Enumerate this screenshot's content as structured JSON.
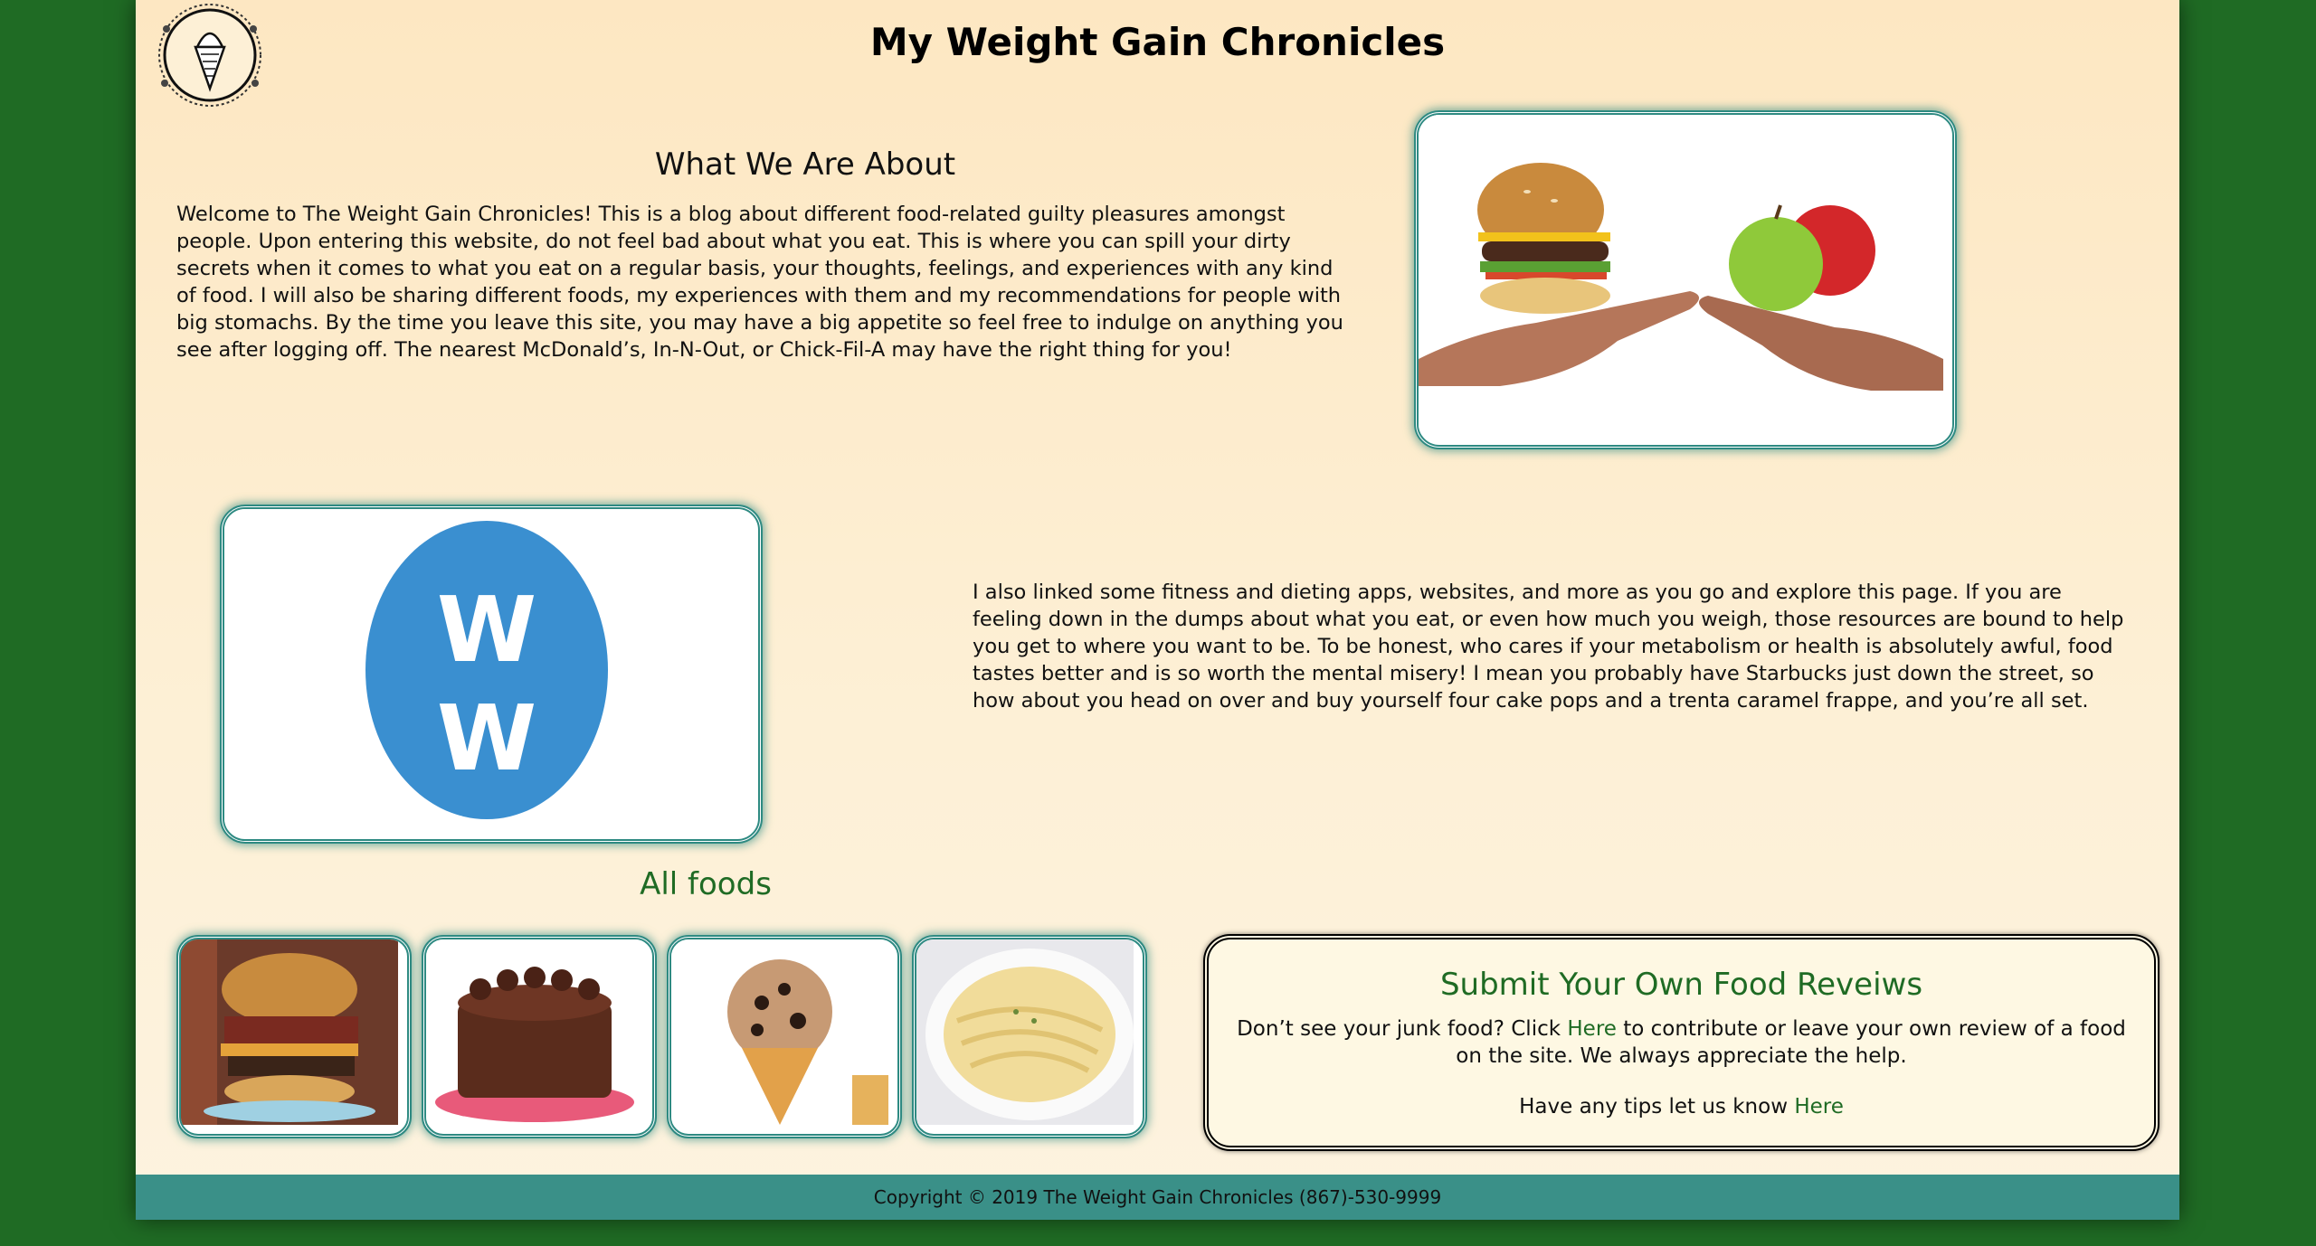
{
  "site": {
    "title": "My Weight Gain Chronicles"
  },
  "about": {
    "heading": "What We Are About",
    "paragraph1": "Welcome to The Weight Gain Chronicles! This is a blog about different food-related guilty pleasures amongst people. Upon entering this website, do not feel bad about what you eat. This is where you can spill your dirty secrets when it comes to what you eat on a regular basis, your thoughts, feelings, and experiences with any kind of food. I will also be sharing different foods, my experiences with them and my recommendations for people with big stomachs. By the time you leave this site, you may have a big appetite so feel free to indulge on anything you see after logging off. The nearest McDonald’s, In-N-Out, or Chick-Fil-A may have the right thing for you!",
    "paragraph2": "I also linked some fitness and dieting apps, websites, and more as you go and explore this page. If you are feeling down in the dumps about what you eat, or even how much you weigh, those resources are bound to help you get to where you want to be. To be honest, who cares if your metabolism or health is absolutely awful, food tastes better and is so worth the mental misery! I mean you probably have Starbucks just down the street, so how about you head on over and buy yourself four cake pops and a trenta caramel frappe, and you’re all set."
  },
  "foods": {
    "heading": "All foods"
  },
  "submit": {
    "heading": "Submit Your Own Food Reveiws",
    "text_before": "Don’t see your junk food? Click ",
    "link1": "Here",
    "text_after": " to contribute or leave your own review of a food on the site. We always appreciate the help.",
    "tips_text": "Have any tips let us know ",
    "link2": "Here"
  },
  "footer": {
    "text": "Copyright © 2019 The Weight Gain Chronicles (867)-530-9999"
  },
  "colors": {
    "background": "#1f6b24",
    "accent": "#2e8a82",
    "link": "#1f6b24",
    "footer": "#3a9088"
  }
}
